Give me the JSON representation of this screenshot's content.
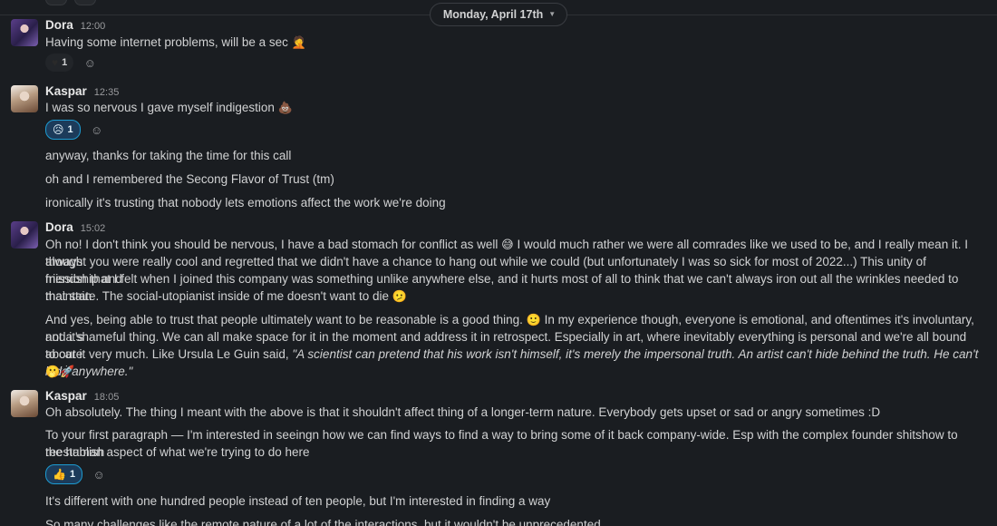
{
  "date_divider": {
    "label": "Monday, April 17th"
  },
  "messages": [
    {
      "author": "Dora",
      "time": "12:00",
      "lines": [
        "Having some internet problems, will be a sec"
      ],
      "reactions": [
        {
          "emoji": "black-heart",
          "glyph": "♥",
          "count": "1",
          "active": false
        }
      ]
    },
    {
      "author": "Kaspar",
      "time": "12:35",
      "lines": [
        "I was so nervous I gave myself indigestion",
        "anyway, thanks for taking the time for this call",
        "oh and I remembered the Secong Flavor of Trust (tm)",
        "ironically it's trusting that nobody lets emotions affect the work we're doing"
      ],
      "reactions": [
        {
          "emoji": "disappointed-relieved-face",
          "glyph": "😥",
          "count": "1",
          "active": true
        }
      ]
    },
    {
      "author": "Dora",
      "time": "15:02",
      "paragraph1": [
        "Oh no! I don't think you should be nervous, I have a bad stomach for conflict as well",
        "I would much rather we were all comrades like we used to be, and I really mean it. I always",
        "thought you were really cool and regretted that we didn't have a chance to hang out while we could (but unfortunately I was so sick for most of 2022...) This unity of friendship and",
        "mission that I felt when I joined this company was something unlike anywhere else, and it hurts most of all to think that we can't always iron out all the wrinkles needed to maintain",
        "that state. The social-utopianist inside of me doesn't want to die"
      ],
      "paragraph2": [
        "And yes, being able to trust that people ultimately want to be reasonable is a good thing.",
        "In my experience though, everyone is emotional, and oftentimes it's involuntary, and it's",
        "not a shameful thing. We can all make space for it in the moment and address it in retrospect. Especially in art, where inevitably everything is personal and we're all bound to care",
        "about it very much. Like Ursula Le Guin said, ",
        "\"A scientist can pretend that his work isn't himself, it's merely the impersonal truth. An artist can't hide behind the truth. He can't hide anywhere.\""
      ]
    },
    {
      "author": "Kaspar",
      "time": "18:05",
      "lines": [
        "Oh absolutely. The thing I meant with the above is that it shouldn't affect thing of a longer-term nature. Everybody gets upset or sad or angry sometimes :D",
        "To your first paragraph — I'm interested in seeingn how we can find ways to find a way to bring some of it back company-wide. Esp with the complex founder shitshow to reestablish",
        "the human aspect of what we're trying to do here",
        "It's different with one hundred people instead of ten people, but I'm interested in finding a way",
        "So many challenges like the remote nature of a lot of the interactions, but it wouldn't be unprecedented"
      ],
      "reactions": [
        {
          "emoji": "thumbs-up",
          "glyph": "👍",
          "count": "1",
          "active": true
        }
      ]
    }
  ],
  "icons": {
    "add_reaction": "add-reaction-icon",
    "woman_facepalming": "🤦",
    "poop": "💩",
    "grinning_sweat": "😅",
    "slightly_frowning": "🫤",
    "slightly_smiling": "🙂",
    "shushing_face": "🫢",
    "rocket": "🚀"
  },
  "colors": {
    "background": "#1a1d21",
    "active_reaction_border": "#1d9bd1",
    "active_reaction_bg": "#1c3b5a"
  }
}
